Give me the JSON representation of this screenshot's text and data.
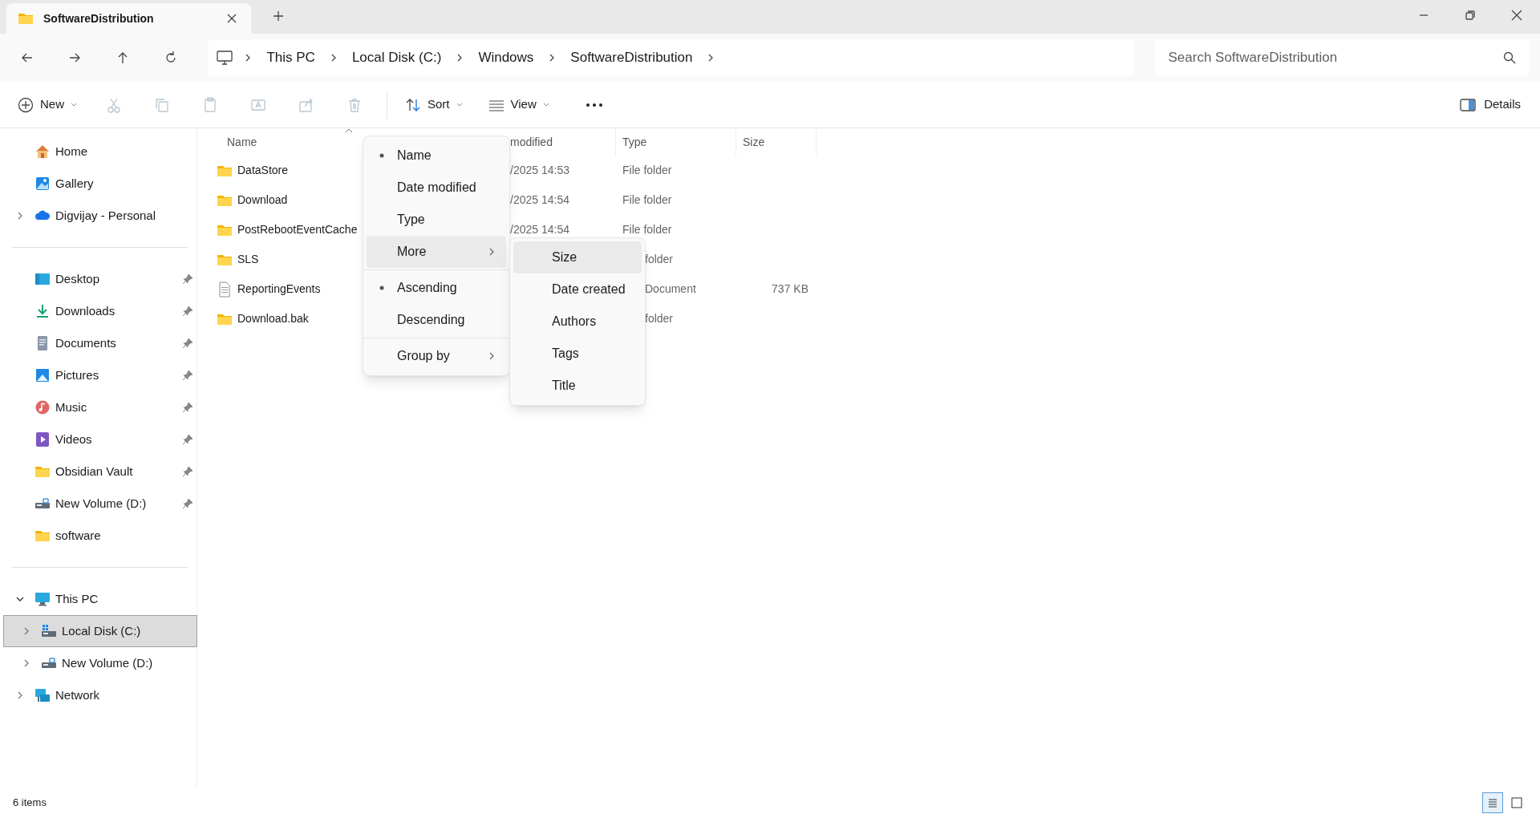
{
  "window": {
    "tab_title": "SoftwareDistribution"
  },
  "address": {
    "crumbs": [
      "This PC",
      "Local Disk (C:)",
      "Windows",
      "SoftwareDistribution"
    ],
    "search": {
      "placeholder": "Search SoftwareDistribution"
    }
  },
  "toolbar": {
    "new_label": "New",
    "icon_buttons": [
      {
        "kind": "cut",
        "disabled": true
      },
      {
        "kind": "copy",
        "disabled": true
      },
      {
        "kind": "paste",
        "disabled": true
      },
      {
        "kind": "rename",
        "disabled": true
      },
      {
        "kind": "share",
        "disabled": true
      },
      {
        "kind": "delete",
        "disabled": true
      }
    ],
    "sort_label": "Sort",
    "view_label": "View",
    "details_label": "Details"
  },
  "sidebar": {
    "groups": [
      [
        {
          "label": "Home",
          "kind": "home"
        },
        {
          "label": "Gallery",
          "kind": "gallery"
        },
        {
          "label": "Digvijay - Personal",
          "kind": "cloud",
          "expanded": false
        }
      ],
      [
        {
          "label": "Desktop",
          "kind": "desktop",
          "pinned": true
        },
        {
          "label": "Downloads",
          "kind": "downloads",
          "pinned": true
        },
        {
          "label": "Documents",
          "kind": "documents",
          "pinned": true
        },
        {
          "label": "Pictures",
          "kind": "pictures",
          "pinned": true
        },
        {
          "label": "Music",
          "kind": "music",
          "pinned": true
        },
        {
          "label": "Videos",
          "kind": "videos",
          "pinned": true
        },
        {
          "label": "Obsidian Vault",
          "kind": "folder",
          "pinned": true
        },
        {
          "label": "New Volume (D:)",
          "kind": "drive",
          "pinned": true
        },
        {
          "label": "software",
          "kind": "folder",
          "pinned": false
        }
      ],
      [
        {
          "label": "This PC",
          "kind": "pc",
          "expanded": true,
          "children": [
            {
              "label": "Local Disk (C:)",
              "kind": "disk_c",
              "expanded": false,
              "selected": true
            },
            {
              "label": "New Volume (D:)",
              "kind": "drive",
              "expanded": false,
              "selected": false
            }
          ]
        },
        {
          "label": "Network",
          "kind": "network",
          "expanded": false
        }
      ]
    ]
  },
  "columns": [
    "Name",
    "modified",
    "Type",
    "Size"
  ],
  "rows": [
    {
      "kind": "folder",
      "name": "DataStore",
      "date": "/2025 14:53",
      "type": "File folder"
    },
    {
      "kind": "folder",
      "name": "Download",
      "date": "/2025 14:54",
      "type": "File folder"
    },
    {
      "kind": "folder",
      "name": "PostRebootEventCache",
      "date": "/2025 14:54",
      "type": "File folder"
    },
    {
      "kind": "folder",
      "name": "SLS",
      "type": "folder"
    },
    {
      "kind": "file",
      "name": "ReportingEvents",
      "type": "Document",
      "size": "737 KB"
    },
    {
      "kind": "folder",
      "name": "Download.bak",
      "type": "folder"
    }
  ],
  "sort_menu": {
    "items": [
      {
        "kind": "option",
        "label": "Name",
        "checked": true,
        "highlighted": false
      },
      {
        "kind": "option",
        "label": "Date modified",
        "checked": false,
        "highlighted": false
      },
      {
        "kind": "option",
        "label": "Type",
        "checked": false,
        "highlighted": false
      },
      {
        "kind": "submenu",
        "label": "More",
        "checked": false,
        "highlighted": true
      },
      {
        "kind": "separator"
      },
      {
        "kind": "option",
        "label": "Ascending",
        "checked": true,
        "highlighted": false
      },
      {
        "kind": "option",
        "label": "Descending",
        "checked": false,
        "highlighted": false
      },
      {
        "kind": "separator"
      },
      {
        "kind": "submenu",
        "label": "Group by",
        "checked": false,
        "highlighted": false
      }
    ],
    "submenu": [
      {
        "label": "Size",
        "highlighted": true
      },
      {
        "label": "Date created",
        "highlighted": false
      },
      {
        "label": "Authors",
        "highlighted": false
      },
      {
        "label": "Tags",
        "highlighted": false
      },
      {
        "label": "Title",
        "highlighted": false
      }
    ]
  },
  "status": {
    "count": "6 items",
    "views": [
      {
        "kind": "details",
        "selected": true
      },
      {
        "kind": "tiles",
        "selected": false
      }
    ]
  }
}
